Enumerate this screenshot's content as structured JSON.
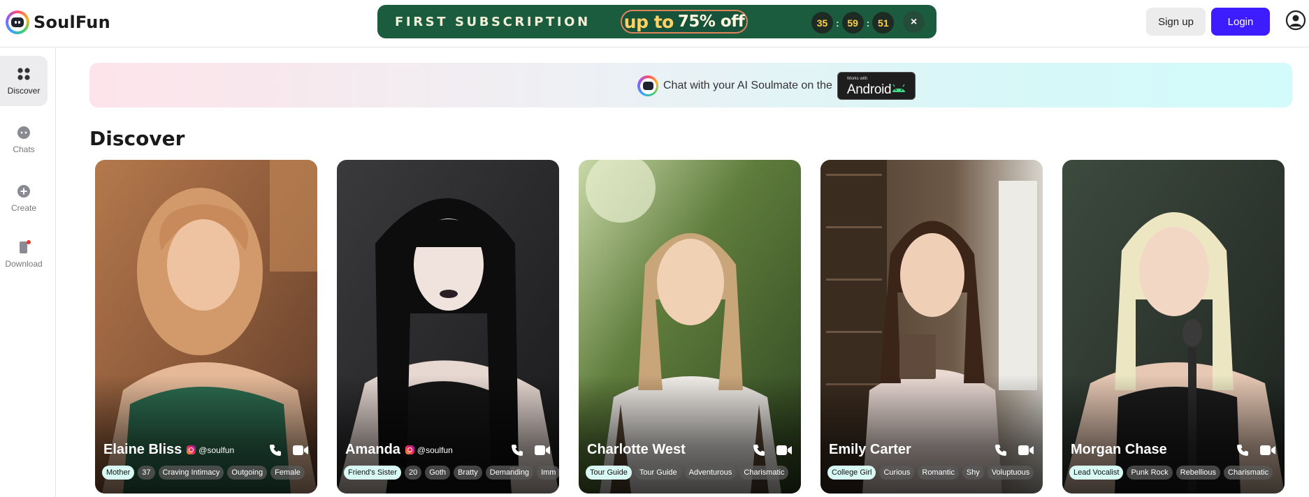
{
  "brand": {
    "name": "SoulFun"
  },
  "promo": {
    "title": "FIRST SUBSCRIPTION",
    "offer_prefix": "up to",
    "offer_main": "75% off",
    "timer": [
      "35",
      "59",
      "51"
    ],
    "close": "×"
  },
  "auth": {
    "signup": "Sign up",
    "login": "Login"
  },
  "sidebar": {
    "items": [
      {
        "label": "Discover",
        "icon": "grid-icon",
        "active": true
      },
      {
        "label": "Chats",
        "icon": "chat-bubble-icon",
        "active": false
      },
      {
        "label": "Create",
        "icon": "plus-circle-icon",
        "active": false
      },
      {
        "label": "Download",
        "icon": "phone-download-icon",
        "active": false,
        "badge": true
      }
    ]
  },
  "banner": {
    "text": "Chat with your AI Soulmate on the",
    "badge_small": "Works with",
    "badge_big": "Android"
  },
  "section_title": "Discover",
  "colors": {
    "accent": "#3d1cff",
    "promo_bg": "#1a5c3d",
    "timer_digits": "#ffcf4a"
  },
  "cards": [
    {
      "name": "Elaine Bliss",
      "handle": "@soulfun",
      "show_handle": true,
      "tags": [
        "Mother",
        "37",
        "Craving Intimacy",
        "Outgoing",
        "Female"
      ]
    },
    {
      "name": "Amanda",
      "handle": "@soulfun",
      "show_handle": true,
      "tags": [
        "Friend's Sister",
        "20",
        "Goth",
        "Bratty",
        "Demanding",
        "Imm"
      ]
    },
    {
      "name": "Charlotte West",
      "handle": "",
      "show_handle": false,
      "tags": [
        "Tour Guide",
        "Tour Guide",
        "Adventurous",
        "Charismatic"
      ]
    },
    {
      "name": "Emily Carter",
      "handle": "",
      "show_handle": false,
      "tags": [
        "College Girl",
        "Curious",
        "Romantic",
        "Shy",
        "Voluptuous"
      ]
    },
    {
      "name": "Morgan Chase",
      "handle": "",
      "show_handle": false,
      "tags": [
        "Lead Vocalist",
        "Punk Rock",
        "Rebellious",
        "Charismatic"
      ]
    }
  ]
}
